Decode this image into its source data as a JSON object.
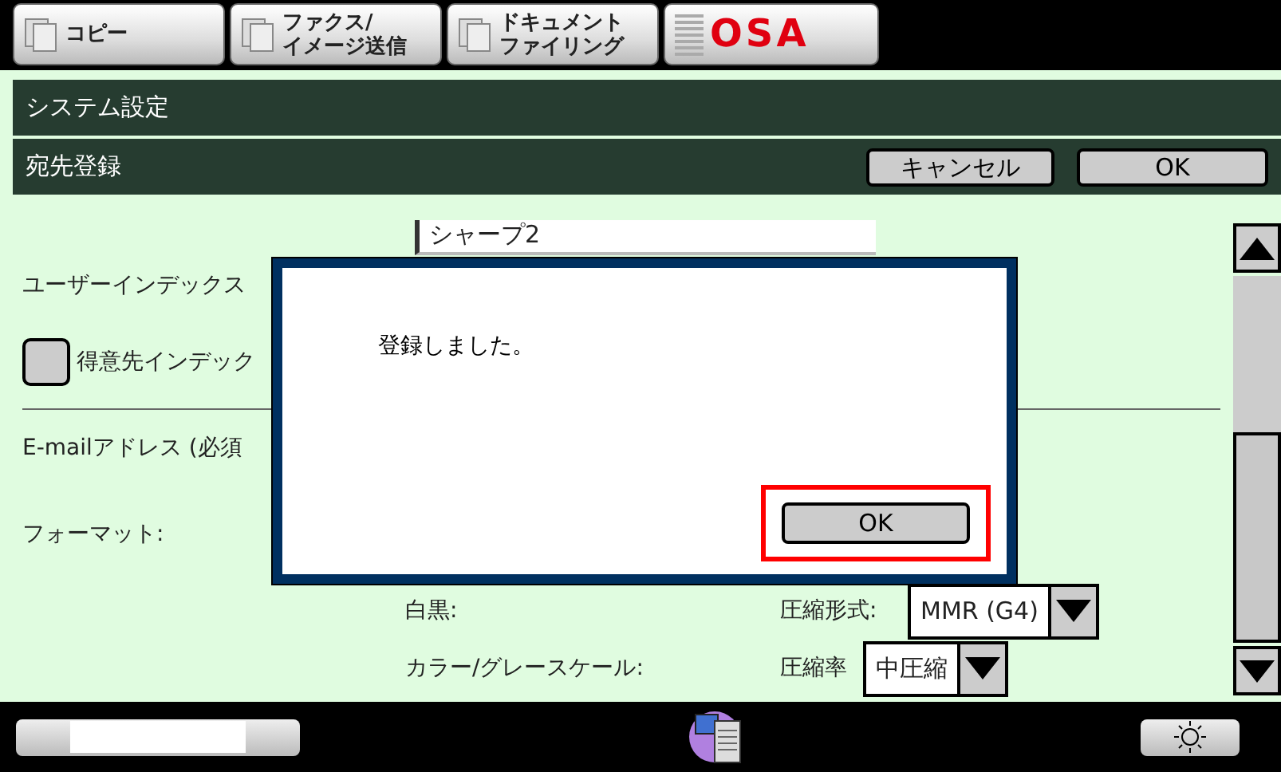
{
  "tabs": [
    {
      "kind": "mode",
      "lines": [
        "コピー"
      ]
    },
    {
      "kind": "mode",
      "lines": [
        "ファクス/",
        "イメージ送信"
      ]
    },
    {
      "kind": "mode",
      "lines": [
        "ドキュメント",
        "ファイリング"
      ]
    },
    {
      "kind": "logo",
      "lines": [
        "OSA"
      ]
    }
  ],
  "breadcrumb": "システム設定",
  "header": {
    "title": "宛先登録",
    "buttons": [
      "キャンセル",
      "OK"
    ]
  },
  "form": {
    "name_value": "シャープ2",
    "user_index_label": "ユーザーインデックス",
    "customer_index": {
      "label": "得意先インデック",
      "checked": false
    },
    "email_label": "E-mailアドレス (必須",
    "format_label": "フォーマット:",
    "mono": {
      "label": "白黒:",
      "field": "圧縮形式:",
      "value": "MMR (G4)"
    },
    "color": {
      "label": "カラー/グレースケール:",
      "field": "圧縮率",
      "value": "中圧縮"
    }
  },
  "dialog": {
    "message": "登録しました。",
    "button": "OK",
    "focused": true
  }
}
